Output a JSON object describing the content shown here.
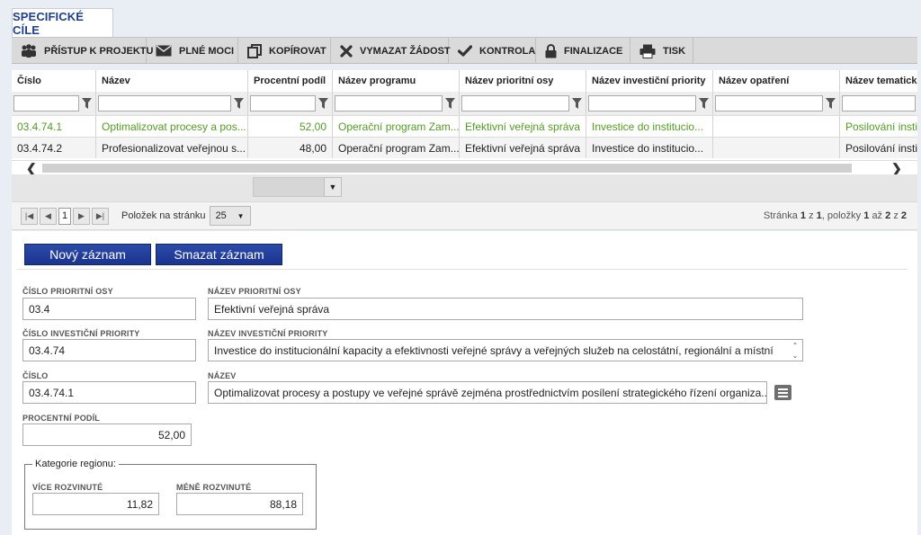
{
  "tab": {
    "label": "SPECIFICKÉ CÍLE"
  },
  "toolbar": {
    "items": [
      {
        "label": "PŘÍSTUP K PROJEKTU",
        "icon": "people-icon"
      },
      {
        "label": "PLNÉ MOCI",
        "icon": "envelope-icon"
      },
      {
        "label": "KOPÍROVAT",
        "icon": "copy-icon"
      },
      {
        "label": "VYMAZAT ŽÁDOST",
        "icon": "x-icon"
      },
      {
        "label": "KONTROLA",
        "icon": "check-icon"
      },
      {
        "label": "FINALIZACE",
        "icon": "lock-icon"
      },
      {
        "label": "TISK",
        "icon": "printer-icon"
      }
    ]
  },
  "grid": {
    "columns": [
      "Číslo",
      "Název",
      "Procentní podíl",
      "Název programu",
      "Název prioritní osy",
      "Název investiční priority",
      "Název opatření",
      "Název tematickéh"
    ],
    "rows": [
      [
        "03.4.74.1",
        "Optimalizovat procesy a pos...",
        "52,00",
        "Operační program Zam...",
        "Efektivní veřejná správa",
        "Investice do institucio...",
        "",
        "Posilování insti"
      ],
      [
        "03.4.74.2",
        "Profesionalizovat veřejnou s...",
        "48,00",
        "Operační program Zam...",
        "Efektivní veřejná správa",
        "Investice do institucio...",
        "",
        "Posilování insti"
      ]
    ]
  },
  "pager": {
    "current_page": "1",
    "per_page_label": "Položek na stránku",
    "per_page_value": "25",
    "info_prefix": "Stránka",
    "info_page": "1",
    "info_of": "z",
    "info_pages": "1",
    "info_items": ", položky",
    "info_from": "1",
    "info_to_word": "až",
    "info_to": "2",
    "info_total_word": "z",
    "info_total": "2"
  },
  "form": {
    "new_button": "Nový záznam",
    "delete_button": "Smazat záznam",
    "priority_axis_number_label": "ČÍSLO PRIORITNÍ OSY",
    "priority_axis_number": "03.4",
    "priority_axis_name_label": "NÁZEV PRIORITNÍ OSY",
    "priority_axis_name": "Efektivní veřejná správa",
    "investment_priority_number_label": "ČÍSLO INVESTIČNÍ PRIORITY",
    "investment_priority_number": "03.4.74",
    "investment_priority_name_label": "NÁZEV INVESTIČNÍ PRIORITY",
    "investment_priority_name": "Investice do institucionální kapacity a efektivnosti veřejné správy a veřejných služeb na celostátní, regionální a místní",
    "number_label": "ČÍSLO",
    "number": "03.4.74.1",
    "name_label": "NÁZEV",
    "name": "Optimalizovat procesy a postupy ve veřejné správě zejména prostřednictvím posílení strategického řízení organiza...",
    "percent_label": "PROCENTNÍ PODÍL",
    "percent": "52,00",
    "region_legend": "Kategorie regionu:",
    "more_developed_label": "VÍCE ROZVINUTÉ",
    "more_developed": "11,82",
    "less_developed_label": "MÉNĚ ROZVINUTÉ",
    "less_developed": "88,18"
  }
}
